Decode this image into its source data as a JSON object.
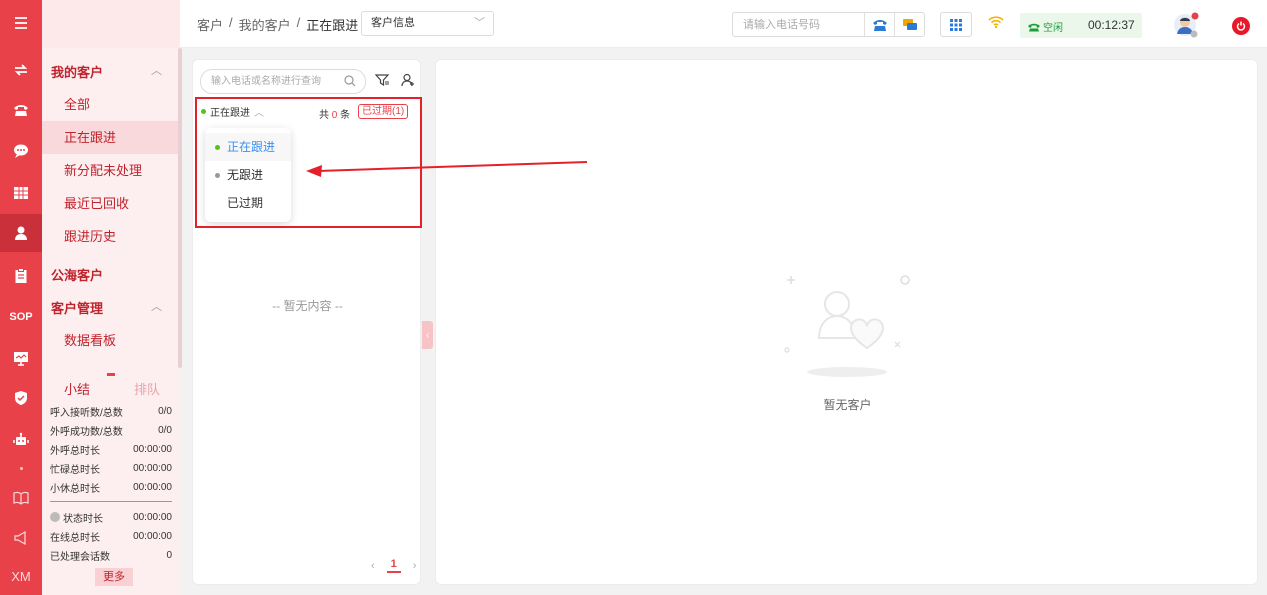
{
  "rail": {
    "items": [
      {
        "icon": "menu-icon"
      },
      {
        "icon": "transfer-icon"
      },
      {
        "icon": "phone-icon"
      },
      {
        "icon": "chat-icon"
      },
      {
        "icon": "grid-icon"
      },
      {
        "icon": "user-icon",
        "active": true
      },
      {
        "icon": "clipboard-icon"
      },
      {
        "icon": "sop-text",
        "label": "SOP"
      },
      {
        "icon": "monitor-icon"
      },
      {
        "icon": "shield-icon"
      },
      {
        "icon": "robot-icon"
      },
      {
        "icon": "book-icon"
      },
      {
        "icon": "megaphone-icon"
      },
      {
        "icon": "xm-text",
        "label": "XM"
      }
    ]
  },
  "menu": {
    "groups": [
      {
        "label": "我的客户",
        "items": [
          "全部",
          "正在跟进",
          "新分配未处理",
          "最近已回收",
          "跟进历史"
        ]
      },
      {
        "label": "公海客户"
      },
      {
        "label": "客户管理",
        "items": [
          "数据看板"
        ]
      }
    ]
  },
  "stats": {
    "tab_summary": "小结",
    "tab_queue": "排队",
    "rows": [
      {
        "label": "呼入接听数/总数",
        "value": "0/0"
      },
      {
        "label": "外呼成功数/总数",
        "value": "0/0"
      },
      {
        "label": "外呼总时长",
        "value": "00:00:00"
      },
      {
        "label": "忙碌总时长",
        "value": "00:00:00"
      },
      {
        "label": "小休总时长",
        "value": "00:00:00"
      },
      {
        "label": "状态时长",
        "value": "00:00:00"
      },
      {
        "label": "在线总时长",
        "value": "00:00:00"
      },
      {
        "label": "已处理会话数",
        "value": "0"
      }
    ],
    "more": "更多"
  },
  "header": {
    "breadcrumb": [
      "客户",
      "我的客户",
      "正在跟进"
    ],
    "select_value": "客户信息",
    "phone_placeholder": "请输入电话号码",
    "status_label": "空闲",
    "timer": "00:12:37"
  },
  "left_panel": {
    "search_placeholder": "输入电话或名称进行查询",
    "filter_label": "正在跟进",
    "total_prefix": "共",
    "total_count": "0",
    "total_suffix": "条",
    "expired_label": "已过期(1)",
    "dropdown": [
      {
        "label": "正在跟进",
        "dot": "#52c41a",
        "selected": true
      },
      {
        "label": "无跟进",
        "dot": "#999999"
      },
      {
        "label": "已过期"
      }
    ],
    "empty_text": "-- 暂无内容 --",
    "page": "1"
  },
  "right_panel": {
    "empty_text": "暂无客户"
  },
  "colors": {
    "brand": "#e8414a",
    "menu_bg": "#fdeff0",
    "annotation": "#e4212a",
    "status_green": "#1a9e3a"
  }
}
